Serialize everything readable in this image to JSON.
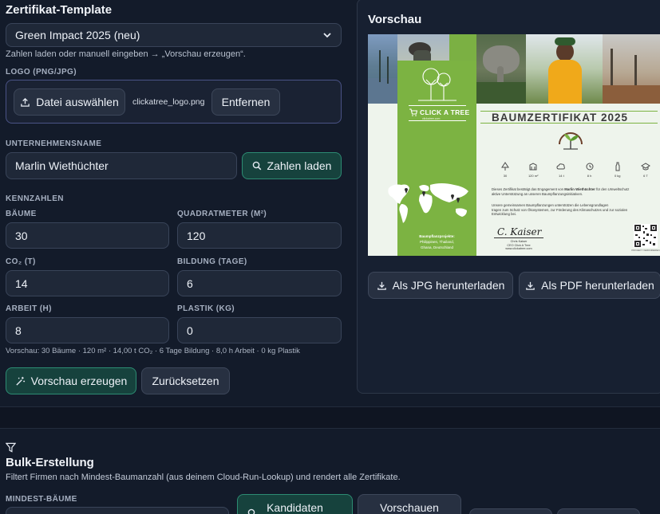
{
  "template": {
    "title": "Zertifikat-Template",
    "select_value": "Green Impact 2025 (neu)",
    "hint": "Zahlen laden oder manuell eingeben → „Vorschau erzeugen“.",
    "logo_label": "LOGO (PNG/JPG)",
    "choose_file_label": "Datei auswählen",
    "file_name": "clickatree_logo.png",
    "remove_label": "Entfernen",
    "company_label": "UNTERNEHMENSNAME",
    "company_value": "Marlin Wiethüchter",
    "load_numbers_label": "Zahlen laden",
    "metrics_label": "KENNZAHLEN",
    "trees_label": "BÄUME",
    "trees_value": "30",
    "sqm_label": "QUADRATMETER (M²)",
    "sqm_value": "120",
    "co2_label": "CO₂ (T)",
    "co2_value": "14",
    "education_label": "BILDUNG (TAGE)",
    "education_value": "6",
    "work_label": "ARBEIT (H)",
    "work_value": "8",
    "plastic_label": "PLASTIK (KG)",
    "plastic_value": "0",
    "summary": "Vorschau: 30 Bäume · 120 m² · 14,00 t CO₂ · 6 Tage Bildung · 8,0 h Arbeit · 0 kg Plastik",
    "generate_label": "Vorschau erzeugen",
    "reset_label": "Zurücksetzen"
  },
  "preview": {
    "title": "Vorschau",
    "download_jpg": "Als JPG herunterladen",
    "download_pdf": "Als PDF herunterladen",
    "certificate": {
      "brand": "CLICK A TREE",
      "brand_url": "clickatree.com",
      "heading": "BAUMZERTIFIKAT 2025",
      "stats": [
        "30",
        "120 m²",
        "14 t",
        "8 h",
        "0 kg",
        "6 T"
      ],
      "text1_a": "Dieses Zertifikat bestätigt das Engagement von",
      "text1_name": "Marlin Wiethüchter",
      "text1_b": "für den Umweltschutz",
      "text1_c": "aktive Unterstützung an unseren Baumpflanzungsinitiativen.",
      "text2_a": "Unsere gemeinsamen Baumpflanzungen unterstützen die Lebensgrundlagen",
      "text2_b": "tragen zum Schutz von Ökosystemen, zur Förderung des Klimaschutzes und zur sozialen",
      "text2_c": "Entwicklung bei.",
      "projects_title": "Baumpflanzprojekte:",
      "projects_line1": "Philippinen, Thailand,",
      "projects_line2": "Ghana, Deutschland",
      "signature": "C. Kaiser",
      "signer_name": "Chris Kaiser",
      "signer_role": "CEO Click A Tree",
      "signer_url": "www.clickatree.com",
      "qr_label": "PROJEKT VERIFIZIEREN"
    }
  },
  "bulk": {
    "title": "Bulk-Erstellung",
    "description": "Filtert Firmen nach Mindest-Baumanzahl (aus deinem Cloud-Run-Lookup) und rendert alle Zertifikate.",
    "min_trees_label": "MINDEST-BÄUME",
    "candidates_label": "Kandidaten",
    "previews_label": "Vorschauen"
  },
  "colors": {
    "background": "#131b2a",
    "accent_green": "#2d8c73",
    "cert_green": "#7cb342"
  }
}
